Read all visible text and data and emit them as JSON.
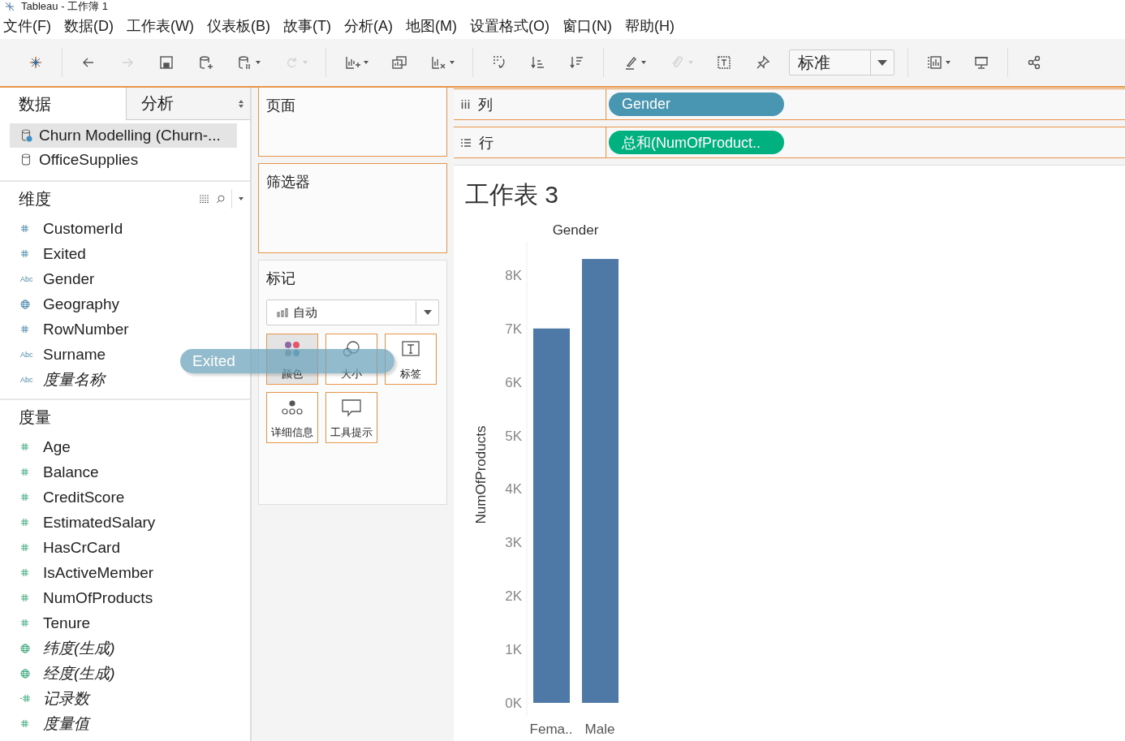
{
  "window": {
    "title": "Tableau - 工作簿 1"
  },
  "menu": [
    "文件(F)",
    "数据(D)",
    "工作表(W)",
    "仪表板(B)",
    "故事(T)",
    "分析(A)",
    "地图(M)",
    "设置格式(O)",
    "窗口(N)",
    "帮助(H)"
  ],
  "toolbar": [
    [
      {
        "kind": "logo",
        "disabled": false,
        "menu": false
      }
    ],
    [
      {
        "kind": "back",
        "disabled": false,
        "menu": false
      },
      {
        "kind": "forward",
        "disabled": true,
        "menu": false
      },
      {
        "kind": "save",
        "disabled": false,
        "menu": false
      },
      {
        "kind": "add-datasource",
        "disabled": false,
        "menu": false
      },
      {
        "kind": "pause",
        "disabled": false,
        "menu": true
      },
      {
        "kind": "refresh",
        "disabled": true,
        "menu": true
      }
    ],
    [
      {
        "kind": "new-sheet",
        "disabled": false,
        "menu": true
      },
      {
        "kind": "duplicate",
        "disabled": false,
        "menu": false
      },
      {
        "kind": "clear",
        "disabled": false,
        "menu": true
      }
    ],
    [
      {
        "kind": "swap",
        "disabled": false,
        "menu": false
      },
      {
        "kind": "sort-asc",
        "disabled": false,
        "menu": false
      },
      {
        "kind": "sort-desc",
        "disabled": false,
        "menu": false
      }
    ],
    [
      {
        "kind": "highlight",
        "disabled": false,
        "menu": true
      },
      {
        "kind": "clip",
        "disabled": true,
        "menu": true
      },
      {
        "kind": "text",
        "disabled": false,
        "menu": false
      },
      {
        "kind": "pin",
        "disabled": false,
        "menu": false
      },
      {
        "kind": "fit",
        "value": "标准"
      }
    ],
    [
      {
        "kind": "show-me",
        "disabled": false,
        "menu": true
      },
      {
        "kind": "present",
        "disabled": false,
        "menu": false
      }
    ],
    [
      {
        "kind": "share",
        "disabled": false,
        "menu": false
      }
    ]
  ],
  "sidebar": {
    "tabs": [
      {
        "label": "数据",
        "selected": true
      },
      {
        "label": "分析",
        "selected": false
      }
    ],
    "datasources": [
      {
        "label": "Churn Modelling (Churn-...",
        "selected": true
      },
      {
        "label": "OfficeSupplies",
        "selected": false
      }
    ],
    "sections": [
      {
        "title": "维度",
        "kind": "dimension",
        "fields": [
          {
            "label": "CustomerId",
            "kind": "number",
            "generated": false
          },
          {
            "label": "Exited",
            "kind": "number",
            "generated": false
          },
          {
            "label": "Gender",
            "kind": "text",
            "icon_text": "Abc",
            "generated": false
          },
          {
            "label": "Geography",
            "kind": "geo",
            "generated": false
          },
          {
            "label": "RowNumber",
            "kind": "number",
            "generated": false
          },
          {
            "label": "Surname",
            "kind": "text",
            "icon_text": "Abc",
            "generated": false
          },
          {
            "label": "度量名称",
            "kind": "text",
            "icon_text": "Abc",
            "generated": true
          }
        ]
      },
      {
        "title": "度量",
        "kind": "measure",
        "fields": [
          {
            "label": "Age",
            "kind": "number",
            "generated": false
          },
          {
            "label": "Balance",
            "kind": "number",
            "generated": false
          },
          {
            "label": "CreditScore",
            "kind": "number",
            "generated": false
          },
          {
            "label": "EstimatedSalary",
            "kind": "number",
            "generated": false
          },
          {
            "label": "HasCrCard",
            "kind": "number",
            "generated": false
          },
          {
            "label": "IsActiveMember",
            "kind": "number",
            "generated": false
          },
          {
            "label": "NumOfProducts",
            "kind": "number",
            "generated": false
          },
          {
            "label": "Tenure",
            "kind": "number",
            "generated": false
          },
          {
            "label": "纬度(生成)",
            "kind": "geo",
            "generated": true
          },
          {
            "label": "经度(生成)",
            "kind": "geo",
            "generated": true
          },
          {
            "label": "记录数",
            "kind": "count",
            "generated": true
          },
          {
            "label": "度量值",
            "kind": "number",
            "generated": true
          }
        ]
      }
    ]
  },
  "cards": {
    "pages": {
      "title": "页面"
    },
    "filters": {
      "title": "筛选器"
    },
    "marks": {
      "title": "标记",
      "mark_type": "自动",
      "buttons": [
        {
          "label": "颜色",
          "kind": "color",
          "selected": true
        },
        {
          "label": "大小",
          "kind": "size",
          "selected": false
        },
        {
          "label": "标签",
          "kind": "label",
          "selected": false
        },
        {
          "label": "详细信息",
          "kind": "detail",
          "selected": false
        },
        {
          "label": "工具提示",
          "kind": "tooltip",
          "selected": false
        }
      ]
    }
  },
  "drag_pill": {
    "label": "Exited"
  },
  "shelves": [
    {
      "label": "列",
      "kind": "columns",
      "pill": "Gender",
      "color": "#4996b2"
    },
    {
      "label": "行",
      "kind": "rows",
      "pill": "总和(NumOfProduct..",
      "color": "#00b180"
    }
  ],
  "sheet": {
    "title": "工作表 3",
    "header": "Gender",
    "chart_data": {
      "type": "bar",
      "ylabel": "NumOfProducts",
      "categories": [
        "Fema..",
        "Male"
      ],
      "values": [
        7000,
        8300
      ],
      "ylim": [
        0,
        8620
      ],
      "yticks": [
        {
          "value": 0,
          "label": "0K"
        },
        {
          "value": 1000,
          "label": "1K"
        },
        {
          "value": 2000,
          "label": "2K"
        },
        {
          "value": 3000,
          "label": "3K"
        },
        {
          "value": 4000,
          "label": "4K"
        },
        {
          "value": 5000,
          "label": "5K"
        },
        {
          "value": 6000,
          "label": "6K"
        },
        {
          "value": 7000,
          "label": "7K"
        },
        {
          "value": 8000,
          "label": "8K"
        }
      ]
    }
  }
}
